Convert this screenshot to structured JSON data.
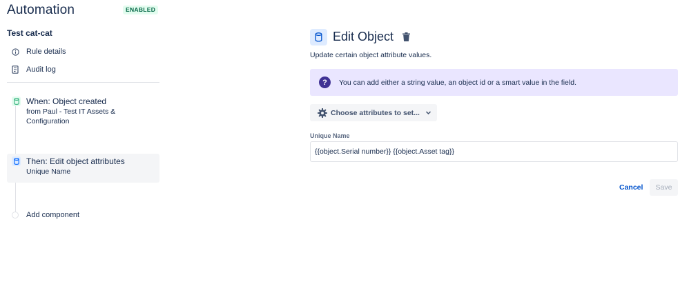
{
  "app": {
    "title": "Automation",
    "status_badge": "ENABLED"
  },
  "rule": {
    "name": "Test cat-cat"
  },
  "nav": {
    "items": [
      {
        "label": "Rule details",
        "icon": "info-icon"
      },
      {
        "label": "Audit log",
        "icon": "audit-log-icon"
      }
    ]
  },
  "steps": [
    {
      "title": "When: Object created",
      "subtitle": "from Paul - Test IT Assets & Configuration",
      "icon": "object-icon"
    },
    {
      "title": "Then: Edit object attributes",
      "subtitle": "Unique Name",
      "icon": "object-icon"
    }
  ],
  "add_component": {
    "label": "Add component"
  },
  "editor": {
    "title": "Edit Object",
    "description": "Update certain object attribute values.",
    "info_banner": "You can add either a string value, an object id or a smart value in the field.",
    "choose_attributes_label": "Choose attributes to set...",
    "field": {
      "label": "Unique Name",
      "value": "{{object.Serial number}} {{object.Asset tag}}"
    },
    "cancel_label": "Cancel",
    "save_label": "Save"
  },
  "colors": {
    "text": "#172B4D",
    "badge_text": "#006644",
    "badge_bg": "#E3FCEF",
    "info_bg": "#EAE6FF",
    "info_icon": "#403294",
    "link": "#0052CC",
    "selected_bg": "#F4F5F7",
    "trigger_icon": "#36B37E",
    "action_icon": "#0065FF"
  }
}
